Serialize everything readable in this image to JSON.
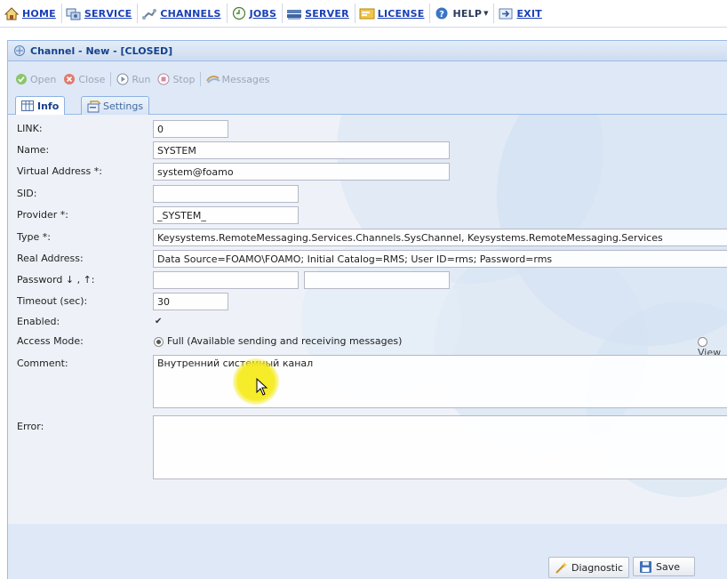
{
  "menu": {
    "items": [
      {
        "label": "HOME",
        "icon": "home-icon"
      },
      {
        "label": "SERVICE",
        "icon": "service-icon"
      },
      {
        "label": "CHANNELS",
        "icon": "channels-icon"
      },
      {
        "label": "JOBS",
        "icon": "jobs-icon"
      },
      {
        "label": "SERVER",
        "icon": "server-icon"
      },
      {
        "label": "LICENSE",
        "icon": "license-icon"
      },
      {
        "label": "HELP",
        "icon": "help-icon"
      },
      {
        "label": "EXIT",
        "icon": "exit-icon"
      }
    ]
  },
  "window": {
    "title": "Channel - New - [CLOSED]"
  },
  "toolbar": {
    "open": "Open",
    "close": "Close",
    "run": "Run",
    "stop": "Stop",
    "messages": "Messages"
  },
  "tabs": {
    "info": "Info",
    "settings": "Settings"
  },
  "form": {
    "link": {
      "label": "LINK:",
      "value": "0"
    },
    "name": {
      "label": "Name:",
      "value": "SYSTEM"
    },
    "virtual_address": {
      "label": "Virtual Address *:",
      "value": "system@foamo"
    },
    "sid": {
      "label": "SID:",
      "value": ""
    },
    "provider": {
      "label": "Provider *:",
      "value": "_SYSTEM_"
    },
    "type": {
      "label": "Type *:",
      "value": "Keysystems.RemoteMessaging.Services.Channels.SysChannel, Keysystems.RemoteMessaging.Services"
    },
    "real_address": {
      "label": "Real Address:",
      "value": "Data Source=FOAMO\\FOAMO; Initial Catalog=RMS; User ID=rms; Password=rms"
    },
    "password": {
      "label": "Password ↓ , ↑:",
      "value1": "",
      "value2": ""
    },
    "timeout": {
      "label": "Timeout (sec):",
      "value": "30"
    },
    "enabled": {
      "label": "Enabled:",
      "checked": true
    },
    "access_mode": {
      "label": "Access Mode:",
      "full": "Full (Available sending and receiving messages)",
      "view": "View"
    },
    "comment": {
      "label": "Comment:",
      "value": "Внутренний системный канал"
    },
    "error": {
      "label": "Error:",
      "value": ""
    }
  },
  "footer": {
    "diagnostic": "Diagnostic",
    "save": "Save"
  },
  "colors": {
    "link_blue": "#1a3fb8",
    "title_blue": "#15428b",
    "panel_bg": "#dfe8f6",
    "highlight": "#f5eb1e"
  }
}
